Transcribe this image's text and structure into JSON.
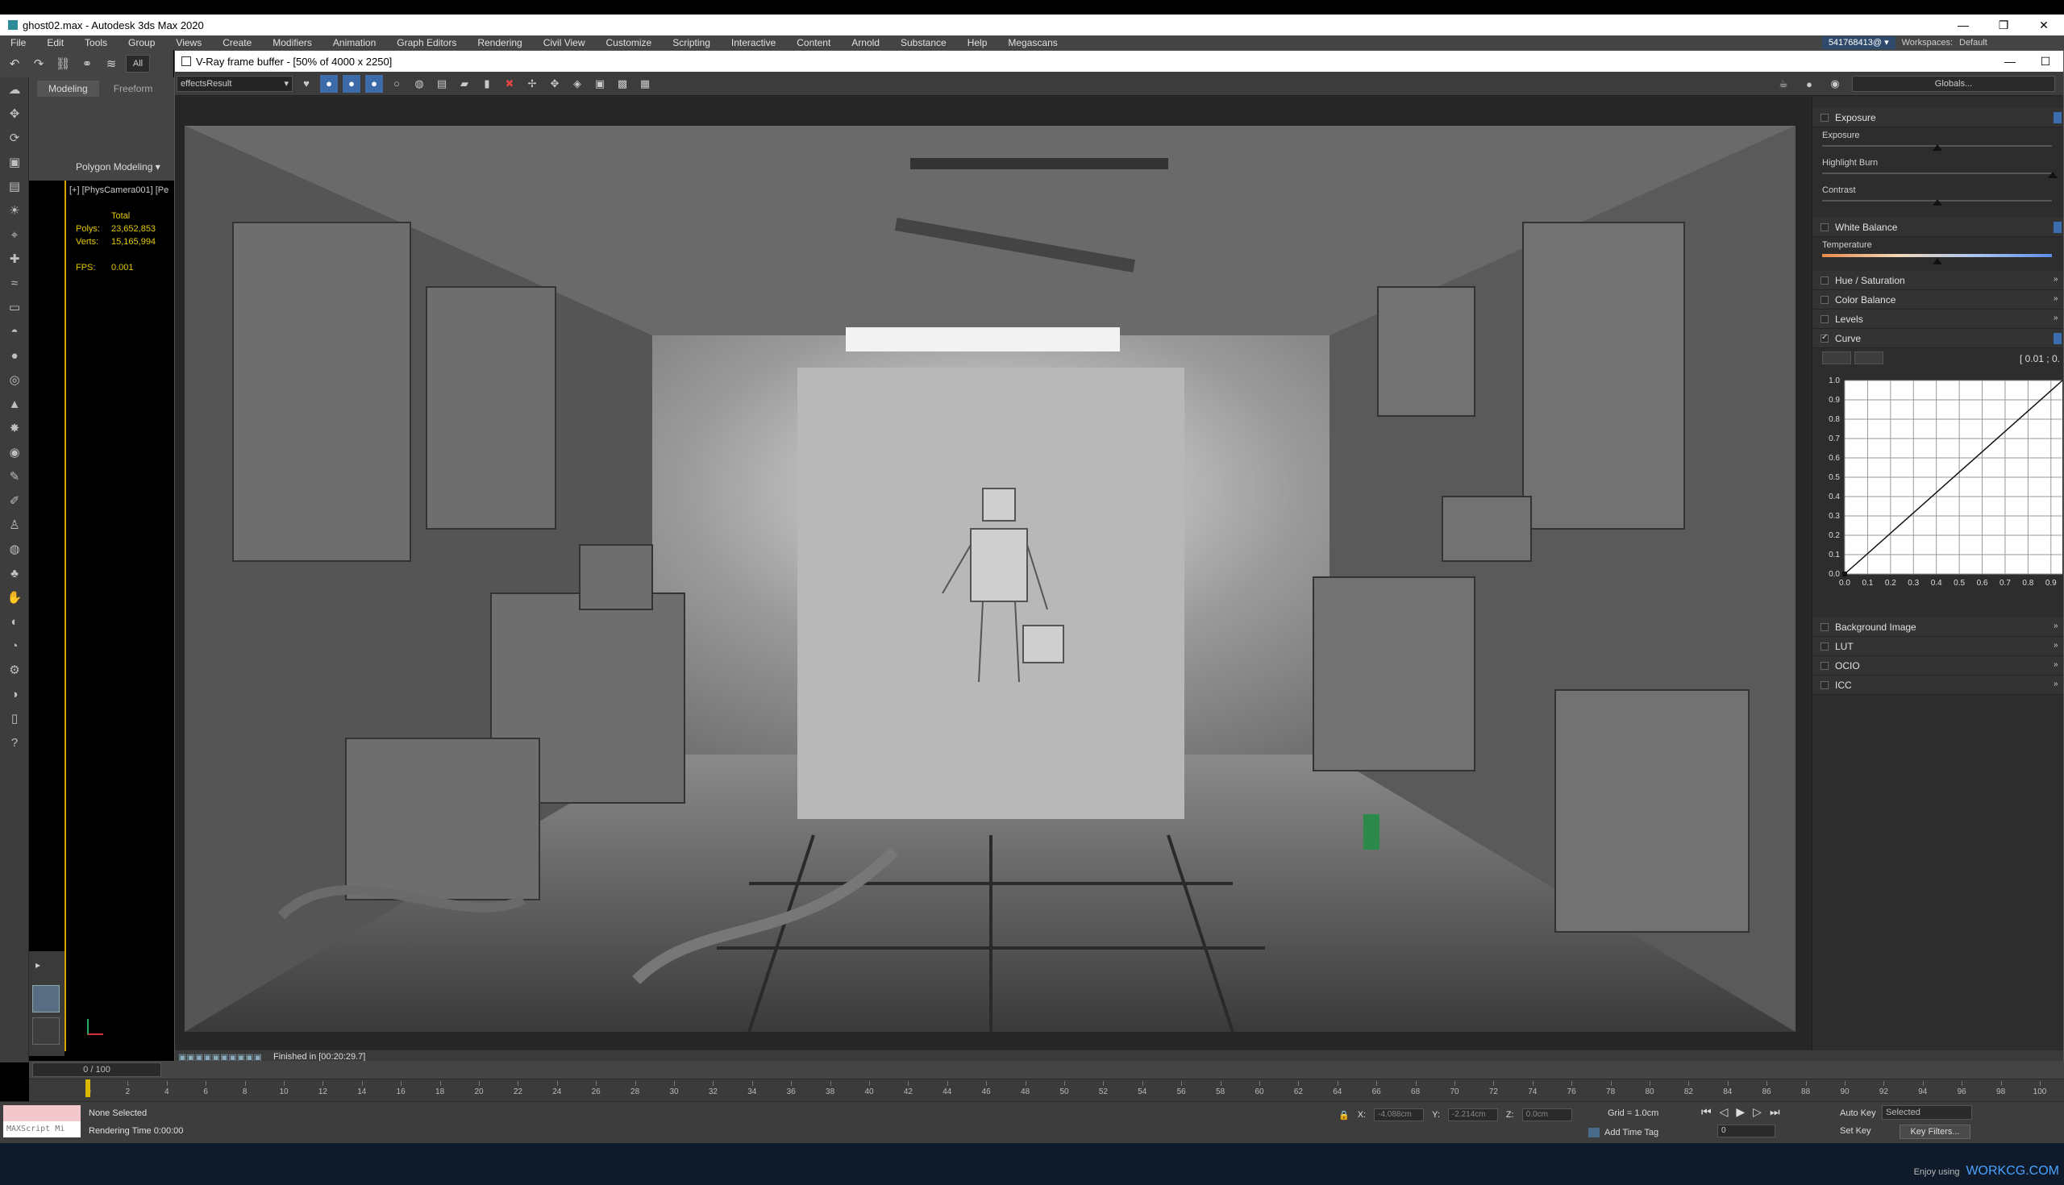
{
  "app": {
    "title": "ghost02.max - Autodesk 3ds Max 2020",
    "window_controls": [
      "—",
      "❐",
      "✕"
    ]
  },
  "menu": {
    "items": [
      "File",
      "Edit",
      "Tools",
      "Group",
      "Views",
      "Create",
      "Modifiers",
      "Animation",
      "Graph Editors",
      "Rendering",
      "Civil View",
      "Customize",
      "Scripting",
      "Interactive",
      "Content",
      "Arnold",
      "Substance",
      "Help",
      "Megascans"
    ],
    "account": "541768413@ ▾",
    "workspaces_label": "Workspaces:",
    "workspaces_value": "Default"
  },
  "main_toolbar": {
    "selection_filter": "All"
  },
  "ribbon": {
    "tabs": [
      "Modeling",
      "Freeform"
    ],
    "panel_label": "Polygon Modeling ▾"
  },
  "viewport": {
    "label": "[+] [PhysCamera001] [Pe",
    "stats_header": "Total",
    "polys_label": "Polys:",
    "polys_value": "23,652,853",
    "verts_label": "Verts:",
    "verts_value": "15,165,994",
    "fps_label": "FPS:",
    "fps_value": "0.001"
  },
  "vfb": {
    "title": "V-Ray frame buffer - [50% of 4000 x 2250]",
    "layer": "effectsResult",
    "globals_button": "Globals...",
    "status": "Finished in [00:20:29.7]"
  },
  "corrections": {
    "exposure": {
      "header": "Exposure",
      "exposure_label": "Exposure",
      "exposure_pos": 0.5,
      "highlight_label": "Highlight Burn",
      "highlight_pos": 1.0,
      "contrast_label": "Contrast",
      "contrast_pos": 0.5
    },
    "white_balance": {
      "header": "White Balance",
      "temperature_label": "Temperature",
      "temperature_pos": 0.5
    },
    "hue_saturation": "Hue / Saturation",
    "color_balance": "Color Balance",
    "levels": "Levels",
    "curve": {
      "header": "Curve",
      "coord": "[ 0.01 ; 0.",
      "y_ticks": [
        "1.0",
        "0.9",
        "0.8",
        "0.7",
        "0.6",
        "0.5",
        "0.4",
        "0.3",
        "0.2",
        "0.1",
        "0.0"
      ],
      "x_ticks": [
        "0.0",
        "0.1",
        "0.2",
        "0.3",
        "0.4",
        "0.5",
        "0.6",
        "0.7",
        "0.8",
        "0.9"
      ]
    },
    "background_image": "Background Image",
    "lut": "LUT",
    "ocio": "OCIO",
    "icc": "ICC"
  },
  "timeline": {
    "frame_range": "0 / 100",
    "ticks": [
      0,
      2,
      4,
      6,
      8,
      10,
      12,
      14,
      16,
      18,
      20,
      22,
      24,
      26,
      28,
      30,
      32,
      34,
      36,
      38,
      40,
      42,
      44,
      46,
      48,
      50,
      52,
      54,
      56,
      58,
      60,
      62,
      64,
      66,
      68,
      70,
      72,
      74,
      76,
      78,
      80,
      82,
      84,
      86,
      88,
      90,
      92,
      94,
      96,
      98,
      100
    ]
  },
  "statusbar": {
    "maxscript": "MAXScript Mi",
    "selection": "None Selected",
    "render_time": "Rendering Time  0:00:00",
    "x_label": "X:",
    "x_value": "-4.088cm",
    "y_label": "Y:",
    "y_value": "-2.214cm",
    "z_label": "Z:",
    "z_value": "0.0cm",
    "grid": "Grid = 1.0cm",
    "add_time_tag": "Add Time Tag",
    "auto_key": "Auto Key",
    "set_key": "Set Key",
    "selected": "Selected",
    "key_filters": "Key Filters...",
    "frame_value": "0"
  },
  "watermark": {
    "prefix": "Enjoy using",
    "brand": "WORKCG.COM"
  },
  "colors": {
    "accent_blue": "#3b6bb0",
    "viewport_text": "#e6c800",
    "curve_bg": "#ffffff"
  }
}
